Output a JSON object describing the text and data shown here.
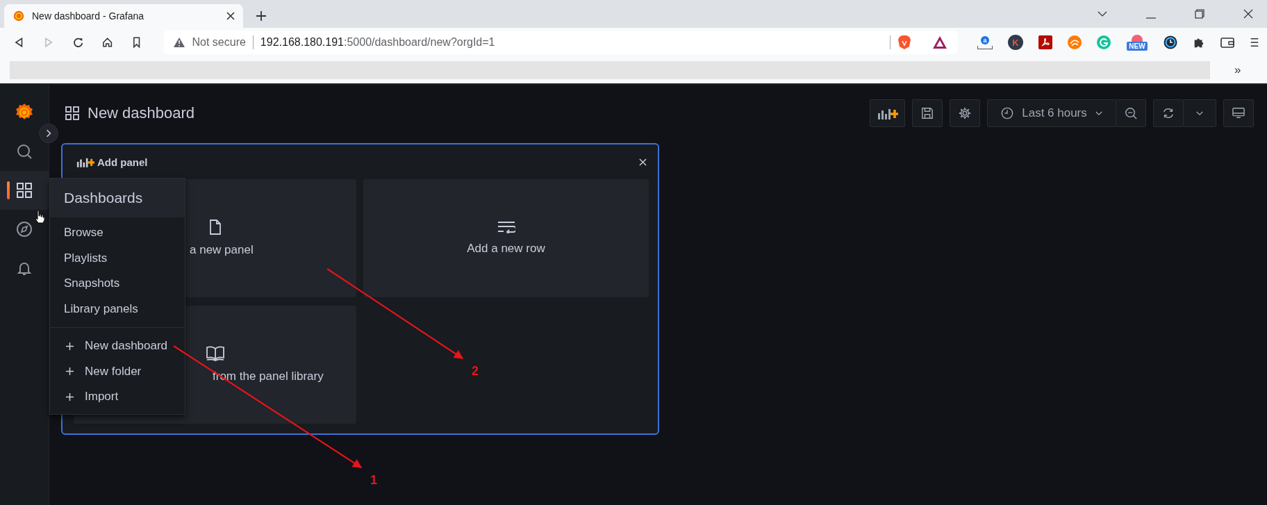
{
  "browser": {
    "tab_title": "New dashboard - Grafana",
    "security": "Not secure",
    "host": "192.168.180.191",
    "path": ":5000/dashboard/new?orgId=1",
    "extensions": [
      {
        "kind": "ruler",
        "glyph": "a"
      },
      {
        "kind": "letter",
        "glyph": "K"
      },
      {
        "kind": "pdf"
      },
      {
        "kind": "swirl"
      },
      {
        "kind": "grammar"
      },
      {
        "kind": "badge",
        "glyph": "NEW"
      },
      {
        "kind": "clock"
      },
      {
        "kind": "puzzle"
      },
      {
        "kind": "wallet"
      }
    ],
    "bookmarks_overflow": "»"
  },
  "sidebar": {
    "items": [
      {
        "kind": "search",
        "selected": false
      },
      {
        "kind": "dashboards",
        "selected": true
      },
      {
        "kind": "explore",
        "selected": false
      },
      {
        "kind": "alerting",
        "selected": false
      }
    ]
  },
  "dashboard": {
    "title": "New dashboard",
    "time_range": "Last 6 hours"
  },
  "add_panel": {
    "title": "Add panel",
    "options": [
      {
        "kind": "panel",
        "label": "a new panel"
      },
      {
        "kind": "row",
        "label": "Add a new row"
      },
      {
        "kind": "library",
        "label": "from the panel library"
      }
    ]
  },
  "menu": {
    "title": "Dashboards",
    "items": [
      {
        "kind": "link",
        "label": "Browse"
      },
      {
        "kind": "link",
        "label": "Playlists"
      },
      {
        "kind": "link",
        "label": "Snapshots"
      },
      {
        "kind": "link",
        "label": "Library panels"
      },
      {
        "kind": "create",
        "label": "New dashboard"
      },
      {
        "kind": "create",
        "label": "New folder"
      },
      {
        "kind": "create",
        "label": "Import"
      }
    ]
  },
  "annotations": [
    {
      "label": "1"
    },
    {
      "label": "2"
    }
  ]
}
